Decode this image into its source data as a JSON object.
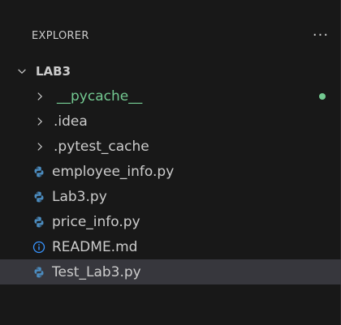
{
  "explorer": {
    "title": "EXPLORER",
    "more_icon": "ellipsis-icon",
    "more_label": "···"
  },
  "colors": {
    "background": "#181818",
    "selected_row": "#37373d",
    "text": "#cccccc",
    "git_untracked": "#73c991",
    "python_icon": "#4b8bbe",
    "info_icon": "#3794ff"
  },
  "tree": {
    "root": {
      "label": "LAB3",
      "expanded": true
    },
    "items": [
      {
        "label": "__pycache__",
        "kind": "folder",
        "expanded": false,
        "git_status": "untracked"
      },
      {
        "label": ".idea",
        "kind": "folder",
        "expanded": false
      },
      {
        "label": ".pytest_cache",
        "kind": "folder",
        "expanded": false
      },
      {
        "label": "employee_info.py",
        "kind": "file",
        "icon": "python-icon"
      },
      {
        "label": "Lab3.py",
        "kind": "file",
        "icon": "python-icon"
      },
      {
        "label": "price_info.py",
        "kind": "file",
        "icon": "python-icon"
      },
      {
        "label": "README.md",
        "kind": "file",
        "icon": "info-icon"
      },
      {
        "label": "Test_Lab3.py",
        "kind": "file",
        "icon": "python-icon",
        "selected": true
      }
    ]
  }
}
